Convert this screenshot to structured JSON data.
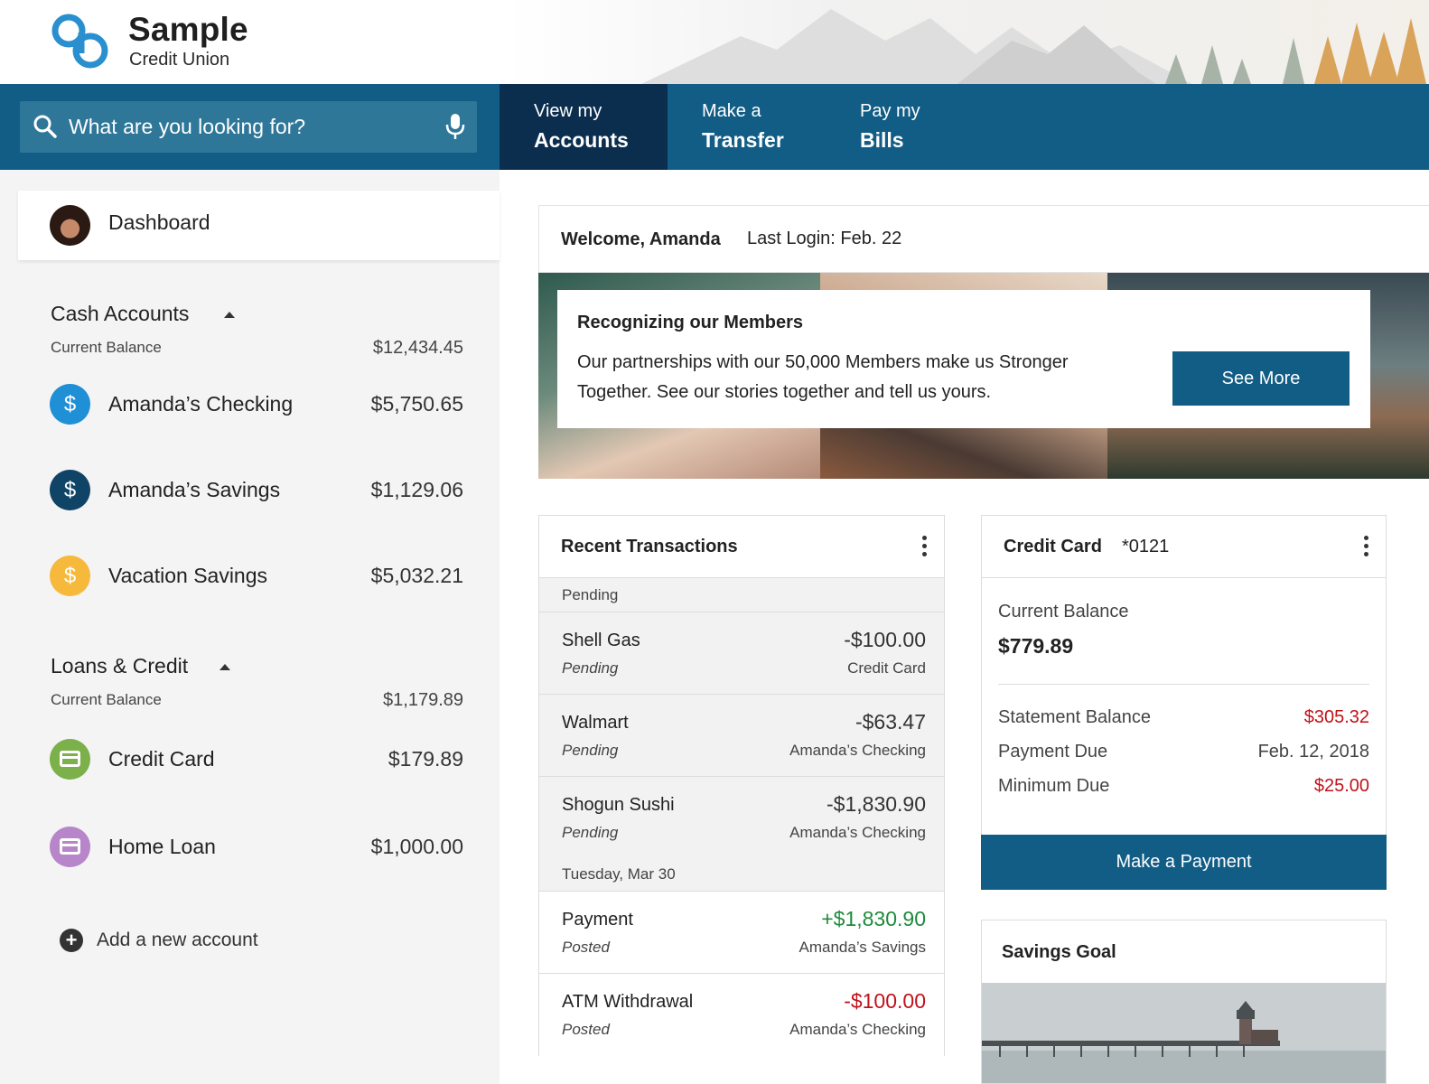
{
  "brand": {
    "name": "Sample",
    "subtitle": "Credit Union",
    "accent": "#125d85",
    "logo_color": "#2a8fcf"
  },
  "search": {
    "placeholder": "What are you looking for?"
  },
  "nav": {
    "tabs": [
      {
        "small": "View my",
        "big": "Accounts",
        "active": true
      },
      {
        "small": "Make a",
        "big": "Transfer",
        "active": false
      },
      {
        "small": "Pay my",
        "big": "Bills",
        "active": false
      }
    ]
  },
  "sidebar": {
    "dashboard_label": "Dashboard",
    "cash": {
      "title": "Cash Accounts",
      "balance_label": "Current Balance",
      "balance_value": "$12,434.45",
      "accounts": [
        {
          "name": "Amanda’s Checking",
          "amount": "$5,750.65",
          "icon": "dollar-icon",
          "color": "#1f8fd6"
        },
        {
          "name": "Amanda’s Savings",
          "amount": "$1,129.06",
          "icon": "dollar-icon",
          "color": "#0f4467"
        },
        {
          "name": "Vacation Savings",
          "amount": "$5,032.21",
          "icon": "dollar-icon",
          "color": "#f6b93b"
        }
      ]
    },
    "loans": {
      "title": "Loans & Credit",
      "balance_label": "Current Balance",
      "balance_value": "$1,179.89",
      "accounts": [
        {
          "name": "Credit Card",
          "amount": "$179.89",
          "icon": "credit-card-icon",
          "color": "#7bb04a"
        },
        {
          "name": "Home Loan",
          "amount": "$1,000.00",
          "icon": "credit-card-icon",
          "color": "#b785c9"
        }
      ]
    },
    "add_account_label": "Add a new account"
  },
  "welcome": {
    "greeting": "Welcome, Amanda",
    "last_login": "Last Login: Feb. 22"
  },
  "promo": {
    "title": "Recognizing our Members",
    "text": "Our partnerships with our 50,000 Members make us Stronger Together. See our stories together and tell us yours.",
    "button": "See More"
  },
  "transactions": {
    "title": "Recent Transactions",
    "groups": [
      {
        "label": "Pending",
        "items": [
          {
            "name": "Shell Gas",
            "status": "Pending",
            "amount": "-$100.00",
            "account": "Credit Card",
            "amount_color": "neutral"
          },
          {
            "name": "Walmart",
            "status": "Pending",
            "amount": "-$63.47",
            "account": "Amanda’s Checking",
            "amount_color": "neutral"
          },
          {
            "name": "Shogun Sushi",
            "status": "Pending",
            "amount": "-$1,830.90",
            "account": "Amanda’s Checking",
            "amount_color": "neutral"
          }
        ]
      },
      {
        "label": "Tuesday, Mar 30",
        "items": [
          {
            "name": "Payment",
            "status": "Posted",
            "amount": "+$1,830.90",
            "account": "Amanda’s Savings",
            "amount_color": "green"
          },
          {
            "name": "ATM Withdrawal",
            "status": "Posted",
            "amount": "-$100.00",
            "account": "Amanda’s Checking",
            "amount_color": "red"
          }
        ]
      }
    ]
  },
  "credit_card": {
    "title": "Credit Card",
    "number": "*0121",
    "current_balance_label": "Current Balance",
    "current_balance": "$779.89",
    "rows": [
      {
        "label": "Statement Balance",
        "value": "$305.32",
        "highlight": true
      },
      {
        "label": "Payment Due",
        "value": "Feb. 12, 2018",
        "highlight": false
      },
      {
        "label": "Minimum Due",
        "value": "$25.00",
        "highlight": true
      }
    ],
    "button": "Make a Payment"
  },
  "savings_goal": {
    "title": "Savings Goal"
  }
}
